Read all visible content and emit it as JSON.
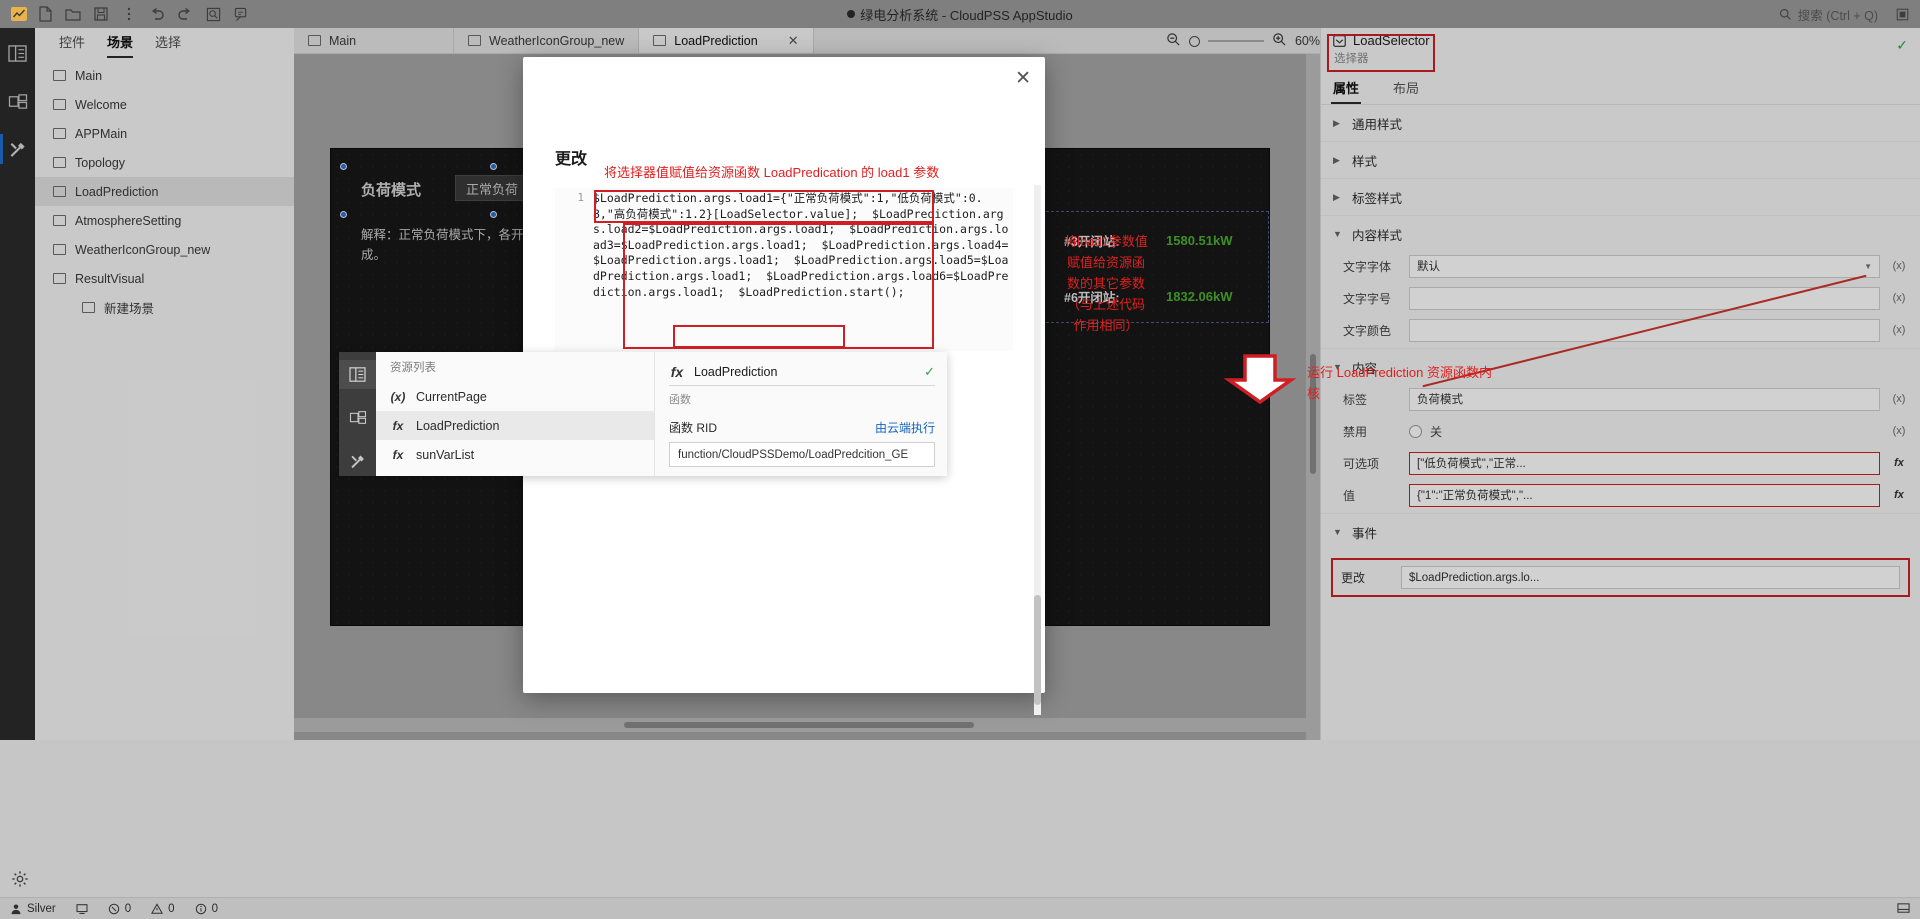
{
  "titlebar": {
    "app_title": "绿电分析系统 - CloudPSS AppStudio",
    "modified_marker": "●",
    "search_placeholder": "搜索 (Ctrl + Q)",
    "search_icon": "search-icon",
    "window_icon": "restore-window-icon"
  },
  "toolbar": {
    "items": [
      {
        "name": "app-logo",
        "glyph": "logo"
      },
      {
        "name": "new-file",
        "glyph": "file"
      },
      {
        "name": "open-folder",
        "glyph": "folder"
      },
      {
        "name": "save",
        "glyph": "save"
      },
      {
        "name": "more-options",
        "glyph": "kebab"
      },
      {
        "name": "undo",
        "glyph": "undo"
      },
      {
        "name": "redo",
        "glyph": "redo"
      },
      {
        "name": "preview",
        "glyph": "preview"
      },
      {
        "name": "publish",
        "glyph": "publish"
      }
    ]
  },
  "rail": {
    "items": [
      {
        "name": "panel-layout-icon",
        "active": false
      },
      {
        "name": "resources-icon",
        "active": false
      },
      {
        "name": "tools-icon",
        "active": true
      }
    ]
  },
  "leftpanel": {
    "tabs": [
      {
        "label": "控件",
        "active": false
      },
      {
        "label": "场景",
        "active": true
      },
      {
        "label": "选择",
        "active": false
      }
    ],
    "scenes": [
      {
        "label": "Main",
        "selected": false,
        "indent": false
      },
      {
        "label": "Welcome",
        "selected": false,
        "indent": false
      },
      {
        "label": "APPMain",
        "selected": false,
        "indent": false
      },
      {
        "label": "Topology",
        "selected": false,
        "indent": false
      },
      {
        "label": "LoadPrediction",
        "selected": true,
        "indent": false
      },
      {
        "label": "AtmosphereSetting",
        "selected": false,
        "indent": false
      },
      {
        "label": "WeatherIconGroup_new",
        "selected": false,
        "indent": false
      },
      {
        "label": "ResultVisual",
        "selected": false,
        "indent": false
      },
      {
        "label": "新建场景",
        "selected": false,
        "indent": true
      }
    ]
  },
  "tabbar": {
    "tabs": [
      {
        "label": "Main",
        "active": false,
        "closable": false
      },
      {
        "label": "WeatherIconGroup_new",
        "active": false,
        "closable": false
      },
      {
        "label": "LoadPrediction",
        "active": true,
        "closable": true,
        "close_label": "✕"
      }
    ]
  },
  "zoombar": {
    "zoom_out_icon": "zoom-out-icon",
    "zoom_in_icon": "zoom-in-icon",
    "level": "60%"
  },
  "canvas": {
    "mode_label": "负荷模式",
    "mode_value": "正常负荷",
    "description": "解释：正常负荷模式下，各开闭站负荷按照设计负荷工况生成。",
    "kpi": [
      {
        "name": "#3开闭站:",
        "value": "1580.51kW"
      },
      {
        "name": "#6开闭站:",
        "value": "1832.06kW"
      }
    ]
  },
  "rightpanel": {
    "component_name": "LoadSelector",
    "component_sub": "选择器",
    "component_icon": "selector-icon",
    "check_icon": "✓",
    "tabs": [
      {
        "label": "属性",
        "active": true
      },
      {
        "label": "布局",
        "active": false
      }
    ],
    "sections": [
      {
        "label": "通用样式",
        "expanded": false
      },
      {
        "label": "样式",
        "expanded": false
      },
      {
        "label": "标签样式",
        "expanded": false
      },
      {
        "label": "内容样式",
        "expanded": true
      },
      {
        "label": "内容",
        "expanded": true
      },
      {
        "label": "事件",
        "expanded": true
      }
    ],
    "content_style": [
      {
        "label": "文字字体",
        "value": "默认",
        "suffix": "(x)",
        "type": "select"
      },
      {
        "label": "文字字号",
        "value": "",
        "suffix": "(x)",
        "type": "text"
      },
      {
        "label": "文字颜色",
        "value": "",
        "suffix": "(x)",
        "type": "color"
      }
    ],
    "content": [
      {
        "label": "标签",
        "value": "负荷模式",
        "suffix": "(x)",
        "type": "text"
      },
      {
        "label": "禁用",
        "value": "关",
        "suffix": "(x)",
        "type": "toggle"
      },
      {
        "label": "可选项",
        "value": "[\"低负荷模式\",\"正常...",
        "suffix": "fx",
        "type": "text",
        "highlight": true
      },
      {
        "label": "值",
        "value": "{\"1\":\"正常负荷模式\",\"...",
        "suffix": "fx",
        "type": "text",
        "highlight": true
      }
    ],
    "events": [
      {
        "label": "更改",
        "value": "$LoadPrediction.args.lo..."
      }
    ]
  },
  "modal": {
    "title": "更改",
    "close_icon": "✕",
    "annotation_top": "将选择器值赋值给资源函数 LoadPredication 的 load1 参数",
    "annotation_left": "将load1参数值赋值给资源函数的其它参数（与上述代码作用相同）",
    "annotation_run": "运行 LoadPrediction 资源函数内核",
    "line_number": "1",
    "code": "$LoadPrediction.args.load1={\"正常负荷模式\":1,\"低负荷模式\":0.8,\"高负荷模式\":1.2}[LoadSelector.value];  $LoadPrediction.args.load2=$LoadPrediction.args.load1;  $LoadPrediction.args.load3=$LoadPrediction.args.load1;  $LoadPrediction.args.load4=$LoadPrediction.args.load1;  $LoadPrediction.args.load5=$LoadPrediction.args.load1;  $LoadPrediction.args.load6=$LoadPrediction.args.load1;  $LoadPrediction.start();",
    "resource_panel": {
      "rail": [
        {
          "name": "resource-list-icon",
          "active": true
        },
        {
          "name": "media-icon",
          "active": false
        },
        {
          "name": "tools-icon",
          "active": false
        }
      ],
      "list_title": "资源列表",
      "items": [
        {
          "label": "CurrentPage",
          "icon": "(x)",
          "selected": false
        },
        {
          "label": "LoadPrediction",
          "icon": "fx",
          "selected": true
        },
        {
          "label": "sunVarList",
          "icon": "fx",
          "selected": false
        }
      ],
      "detail": {
        "icon": "fx",
        "name": "LoadPrediction",
        "check": "✓",
        "subtitle": "函数",
        "rid_label": "函数 RID",
        "cloud_label": "由云端执行",
        "rid_value": "function/CloudPSSDemo/LoadPredcition_GE"
      }
    }
  },
  "statusbar": {
    "user": "Silver",
    "user_icon": "user-icon",
    "device_icon": "device-icon",
    "errors_icon": "error-icon",
    "errors": "0",
    "warnings_icon": "warning-icon",
    "warnings": "0",
    "info_icon": "info-icon",
    "info": "0",
    "notify_icon": "notification-icon"
  },
  "colors": {
    "accent_red": "#cf1f24",
    "annotation_red": "#e02020",
    "kpi_green": "#4caf2e",
    "link_blue": "#1664c0",
    "selection_blue": "#2f6fd8"
  }
}
